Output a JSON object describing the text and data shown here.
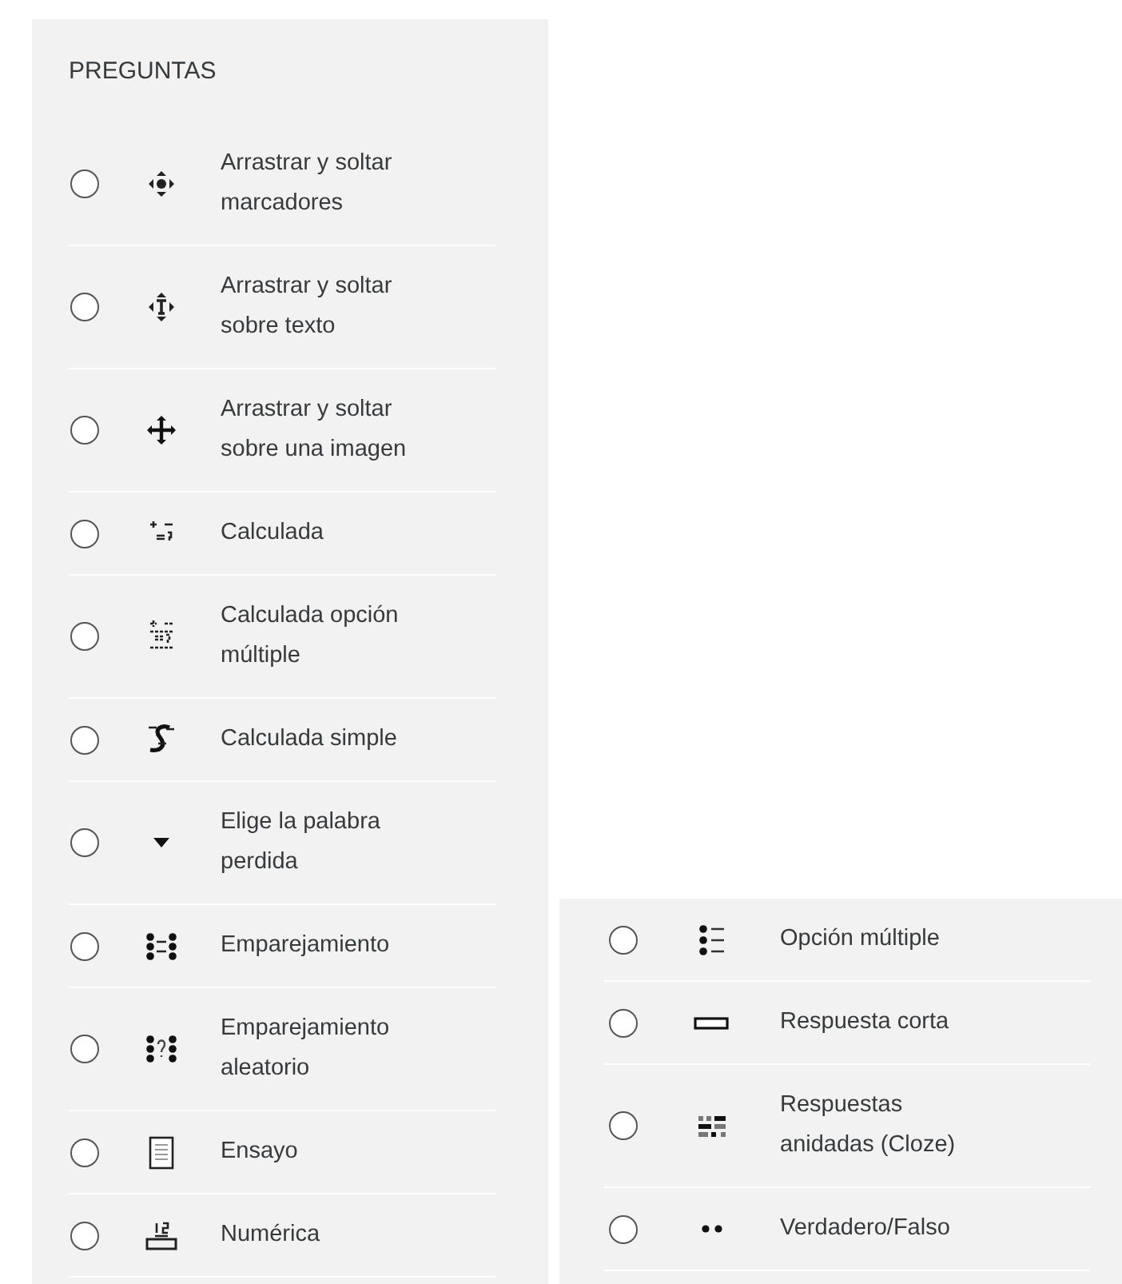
{
  "left_panel": {
    "title": "PREGUNTAS",
    "items": [
      {
        "label": "Arrastrar y soltar marcadores",
        "kind": "ddmarker",
        "selected": false
      },
      {
        "label": "Arrastrar y soltar sobre texto",
        "kind": "ddwtos",
        "selected": false
      },
      {
        "label": "Arrastrar y soltar sobre una imagen",
        "kind": "ddimage",
        "selected": false
      },
      {
        "label": "Calculada",
        "kind": "calculated",
        "selected": false
      },
      {
        "label": "Calculada opción múltiple",
        "kind": "calcmulti",
        "selected": false
      },
      {
        "label": "Calculada simple",
        "kind": "calcsimple",
        "selected": false
      },
      {
        "label": "Elige la palabra perdida",
        "kind": "gapselect",
        "selected": false
      },
      {
        "label": "Emparejamiento",
        "kind": "match",
        "selected": false
      },
      {
        "label": "Emparejamiento aleatorio",
        "kind": "randommatch",
        "selected": false
      },
      {
        "label": "Ensayo",
        "kind": "essay",
        "selected": false
      },
      {
        "label": "Numérica",
        "kind": "numerical",
        "selected": false
      }
    ]
  },
  "right_panel": {
    "items": [
      {
        "label": "Opción múltiple",
        "kind": "multichoice",
        "selected": false
      },
      {
        "label": "Respuesta corta",
        "kind": "shortanswer",
        "selected": false
      },
      {
        "label": "Respuestas anidadas (Cloze)",
        "kind": "multianswer",
        "selected": false
      },
      {
        "label": "Verdadero/Falso",
        "kind": "truefalse",
        "selected": false
      }
    ]
  }
}
